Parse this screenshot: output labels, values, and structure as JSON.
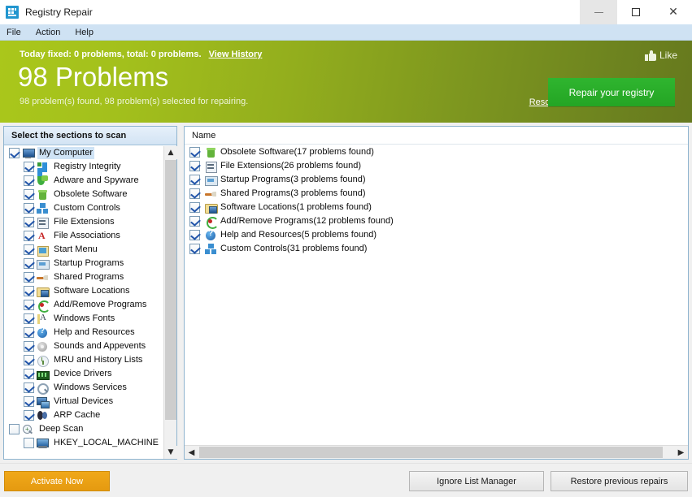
{
  "window": {
    "title": "Registry Repair",
    "app_icon": "registry-grid-icon",
    "controls": {
      "minimize": "minimize-icon",
      "maximize": "maximize-icon",
      "close": "close-icon"
    }
  },
  "menubar": {
    "items": [
      {
        "label": "File"
      },
      {
        "label": "Action"
      },
      {
        "label": "Help"
      }
    ]
  },
  "banner": {
    "fixed_text": "Today fixed: 0 problems, total: 0 problems.",
    "view_history": "View History",
    "headline": "98 Problems",
    "subtext": "98 problem(s) found, 98 problem(s) selected for repairing.",
    "like_label": "Like",
    "like_icon": "thumbs-up-icon",
    "rescan_label": "Rescan",
    "repair_label": "Repair your registry",
    "gradient_start": "#aac71b",
    "gradient_end": "#66791e",
    "repair_button_color": "#2aab2a"
  },
  "left_panel": {
    "header": "Select the sections to scan",
    "tree": [
      {
        "label": "My Computer",
        "icon": "monitor-icon",
        "checked": true,
        "level": 0,
        "selected": true
      },
      {
        "label": "Registry Integrity",
        "icon": "registry-grid-icon",
        "checked": true,
        "level": 1,
        "selected": false
      },
      {
        "label": "Adware and Spyware",
        "icon": "shield-icon",
        "checked": true,
        "level": 1,
        "selected": false
      },
      {
        "label": "Obsolete Software",
        "icon": "recycle-bin-icon",
        "checked": true,
        "level": 1,
        "selected": false
      },
      {
        "label": "Custom Controls",
        "icon": "custom-controls-icon",
        "checked": true,
        "level": 1,
        "selected": false
      },
      {
        "label": "File Extensions",
        "icon": "file-extension-icon",
        "checked": true,
        "level": 1,
        "selected": false
      },
      {
        "label": "File Associations",
        "icon": "letter-a-icon",
        "checked": true,
        "level": 1,
        "selected": false
      },
      {
        "label": "Start Menu",
        "icon": "start-menu-icon",
        "checked": true,
        "level": 1,
        "selected": false
      },
      {
        "label": "Startup Programs",
        "icon": "startup-icon",
        "checked": true,
        "level": 1,
        "selected": false
      },
      {
        "label": "Shared Programs",
        "icon": "shared-programs-icon",
        "checked": true,
        "level": 1,
        "selected": false
      },
      {
        "label": "Software Locations",
        "icon": "software-folder-icon",
        "checked": true,
        "level": 1,
        "selected": false
      },
      {
        "label": "Add/Remove Programs",
        "icon": "add-remove-icon",
        "checked": true,
        "level": 1,
        "selected": false
      },
      {
        "label": "Windows Fonts",
        "icon": "font-icon",
        "checked": true,
        "level": 1,
        "selected": false
      },
      {
        "label": "Help and Resources",
        "icon": "help-question-icon",
        "checked": true,
        "level": 1,
        "selected": false
      },
      {
        "label": "Sounds and Appevents",
        "icon": "sound-disc-icon",
        "checked": true,
        "level": 1,
        "selected": false
      },
      {
        "label": "MRU and History Lists",
        "icon": "history-clock-icon",
        "checked": true,
        "level": 1,
        "selected": false
      },
      {
        "label": "Device Drivers",
        "icon": "device-driver-icon",
        "checked": true,
        "level": 1,
        "selected": false
      },
      {
        "label": "Windows Services",
        "icon": "service-gear-icon",
        "checked": true,
        "level": 1,
        "selected": false
      },
      {
        "label": "Virtual Devices",
        "icon": "virtual-device-icon",
        "checked": true,
        "level": 1,
        "selected": false
      },
      {
        "label": "ARP Cache",
        "icon": "arp-cache-icon",
        "checked": true,
        "level": 1,
        "selected": false
      },
      {
        "label": "Deep Scan",
        "icon": "magnifier-icon",
        "checked": false,
        "level": 0,
        "selected": false
      },
      {
        "label": "HKEY_LOCAL_MACHINE",
        "icon": "registry-hive-icon",
        "checked": false,
        "level": 1,
        "selected": false
      }
    ],
    "scrollbar": {
      "up_arrow": "chevron-up-icon",
      "down_arrow": "chevron-down-icon"
    }
  },
  "right_panel": {
    "column_header": "Name",
    "rows": [
      {
        "label": "Obsolete Software(17 problems found)",
        "icon": "recycle-bin-icon",
        "checked": true,
        "section": "Obsolete Software",
        "problems": 17
      },
      {
        "label": "File Extensions(26 problems found)",
        "icon": "file-extension-icon",
        "checked": true,
        "section": "File Extensions",
        "problems": 26
      },
      {
        "label": "Startup Programs(3 problems found)",
        "icon": "startup-icon",
        "checked": true,
        "section": "Startup Programs",
        "problems": 3
      },
      {
        "label": "Shared Programs(3 problems found)",
        "icon": "shared-programs-icon",
        "checked": true,
        "section": "Shared Programs",
        "problems": 3
      },
      {
        "label": "Software Locations(1 problems found)",
        "icon": "software-folder-icon",
        "checked": true,
        "section": "Software Locations",
        "problems": 1
      },
      {
        "label": "Add/Remove Programs(12 problems found)",
        "icon": "add-remove-icon",
        "checked": true,
        "section": "Add/Remove Programs",
        "problems": 12
      },
      {
        "label": "Help and Resources(5 problems found)",
        "icon": "help-question-icon",
        "checked": true,
        "section": "Help and Resources",
        "problems": 5
      },
      {
        "label": "Custom Controls(31 problems found)",
        "icon": "custom-controls-icon",
        "checked": true,
        "section": "Custom Controls",
        "problems": 31
      }
    ],
    "scrollbar": {
      "left_arrow": "chevron-left-icon",
      "right_arrow": "chevron-right-icon"
    }
  },
  "bottom_bar": {
    "activate_label": "Activate Now",
    "ignore_label": "Ignore List Manager",
    "restore_label": "Restore previous repairs",
    "activate_color": "#eba016"
  }
}
